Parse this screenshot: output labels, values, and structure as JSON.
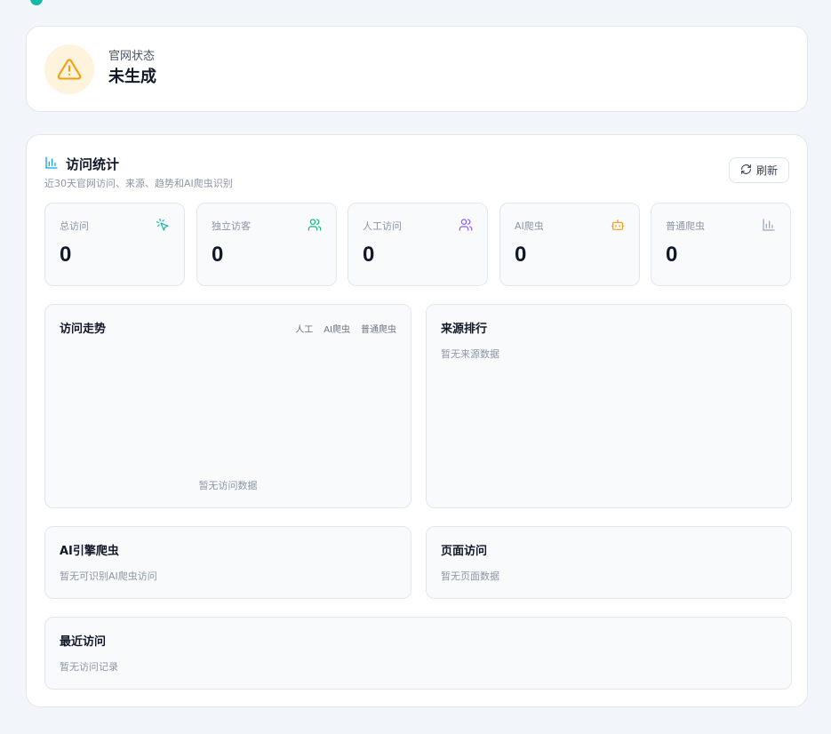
{
  "status": {
    "label": "官网状态",
    "value": "未生成",
    "icon": "warning-icon",
    "accent": "#f59e0b"
  },
  "stats": {
    "title": "访问统计",
    "subtitle": "近30天官网访问、来源、趋势和AI爬虫识别",
    "refresh_label": "刷新",
    "metrics": [
      {
        "label": "总访问",
        "value": "0",
        "icon": "cursor-click-icon",
        "color": "#14b8a6"
      },
      {
        "label": "独立访客",
        "value": "0",
        "icon": "users-icon",
        "color": "#10b981"
      },
      {
        "label": "人工访问",
        "value": "0",
        "icon": "users-icon",
        "color": "#8b5cf6"
      },
      {
        "label": "AI爬虫",
        "value": "0",
        "icon": "bot-icon",
        "color": "#f59e0b"
      },
      {
        "label": "普通爬虫",
        "value": "0",
        "icon": "bar-chart-icon",
        "color": "#94a3b8"
      }
    ]
  },
  "trend": {
    "title": "访问走势",
    "legend": [
      "人工",
      "AI爬虫",
      "普通爬虫"
    ],
    "empty": "暂无访问数据"
  },
  "sources": {
    "title": "来源排行",
    "empty": "暂无来源数据"
  },
  "ai_crawlers": {
    "title": "AI引擎爬虫",
    "empty": "暂无可识别AI爬虫访问"
  },
  "pages": {
    "title": "页面访问",
    "empty": "暂无页面数据"
  },
  "recent": {
    "title": "最近访问",
    "empty": "暂无访问记录"
  }
}
